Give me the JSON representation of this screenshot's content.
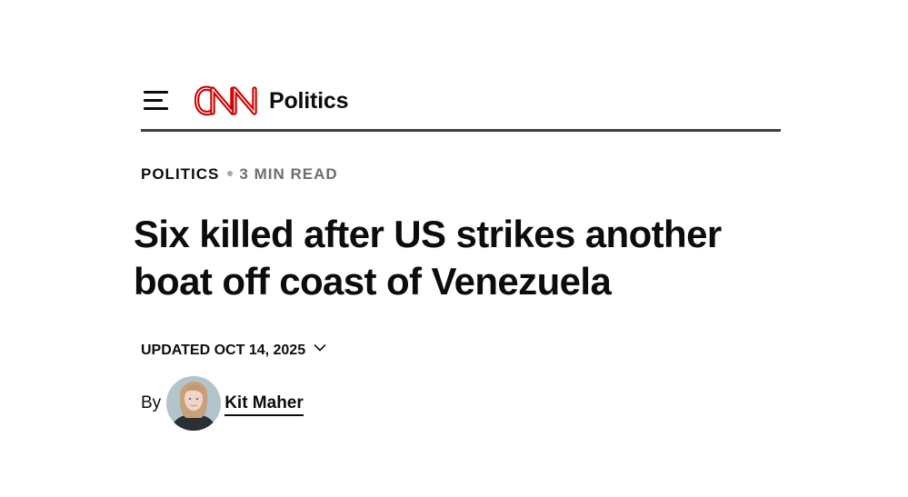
{
  "header": {
    "menu_icon": "hamburger-menu-icon",
    "logo_text": "CNN",
    "logo_color": "#cc0000",
    "section_label": "Politics",
    "rule_color": "#404040"
  },
  "article": {
    "kicker": "POLITICS",
    "read_time": "3 MIN READ",
    "headline": "Six killed after US strikes another boat off coast of Venezuela",
    "timestamp": "UPDATED OCT 14, 2025",
    "timestamp_icon": "chevron-down-icon",
    "byline_prefix": "By",
    "author": "Kit Maher"
  }
}
